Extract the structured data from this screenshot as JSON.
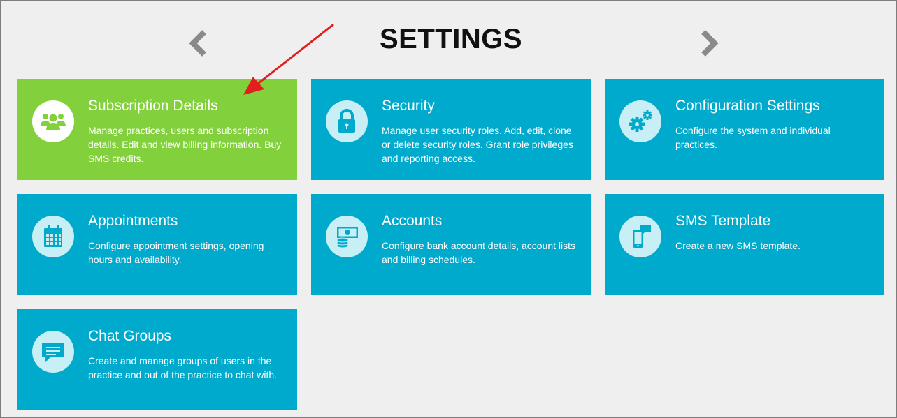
{
  "page": {
    "title": "SETTINGS"
  },
  "nav": {
    "prev_icon": "chevron-left-icon",
    "next_icon": "chevron-right-icon"
  },
  "colors": {
    "tile": "#00aacc",
    "tile_active": "#82d13c",
    "annotation_arrow": "#e21e1e"
  },
  "tiles": [
    {
      "title": "Subscription Details",
      "description": "Manage practices, users and subscription details. Edit and view billing information. Buy SMS credits.",
      "icon": "users-icon",
      "active": true
    },
    {
      "title": "Security",
      "description": "Manage user security roles. Add, edit, clone or delete security roles. Grant role privileges and reporting access.",
      "icon": "lock-icon"
    },
    {
      "title": "Configuration Settings",
      "description": "Configure the system and individual practices.",
      "icon": "gears-icon"
    },
    {
      "title": "Appointments",
      "description": "Configure appointment settings, opening hours and availability.",
      "icon": "calendar-icon"
    },
    {
      "title": "Accounts",
      "description": "Configure bank account details, account lists and billing schedules.",
      "icon": "money-icon"
    },
    {
      "title": "SMS Template",
      "description": "Create a new SMS template.",
      "icon": "phone-message-icon"
    },
    {
      "title": "Chat Groups",
      "description": "Create and manage groups of users in the practice and out of the practice to chat with.",
      "icon": "chat-icon"
    }
  ]
}
